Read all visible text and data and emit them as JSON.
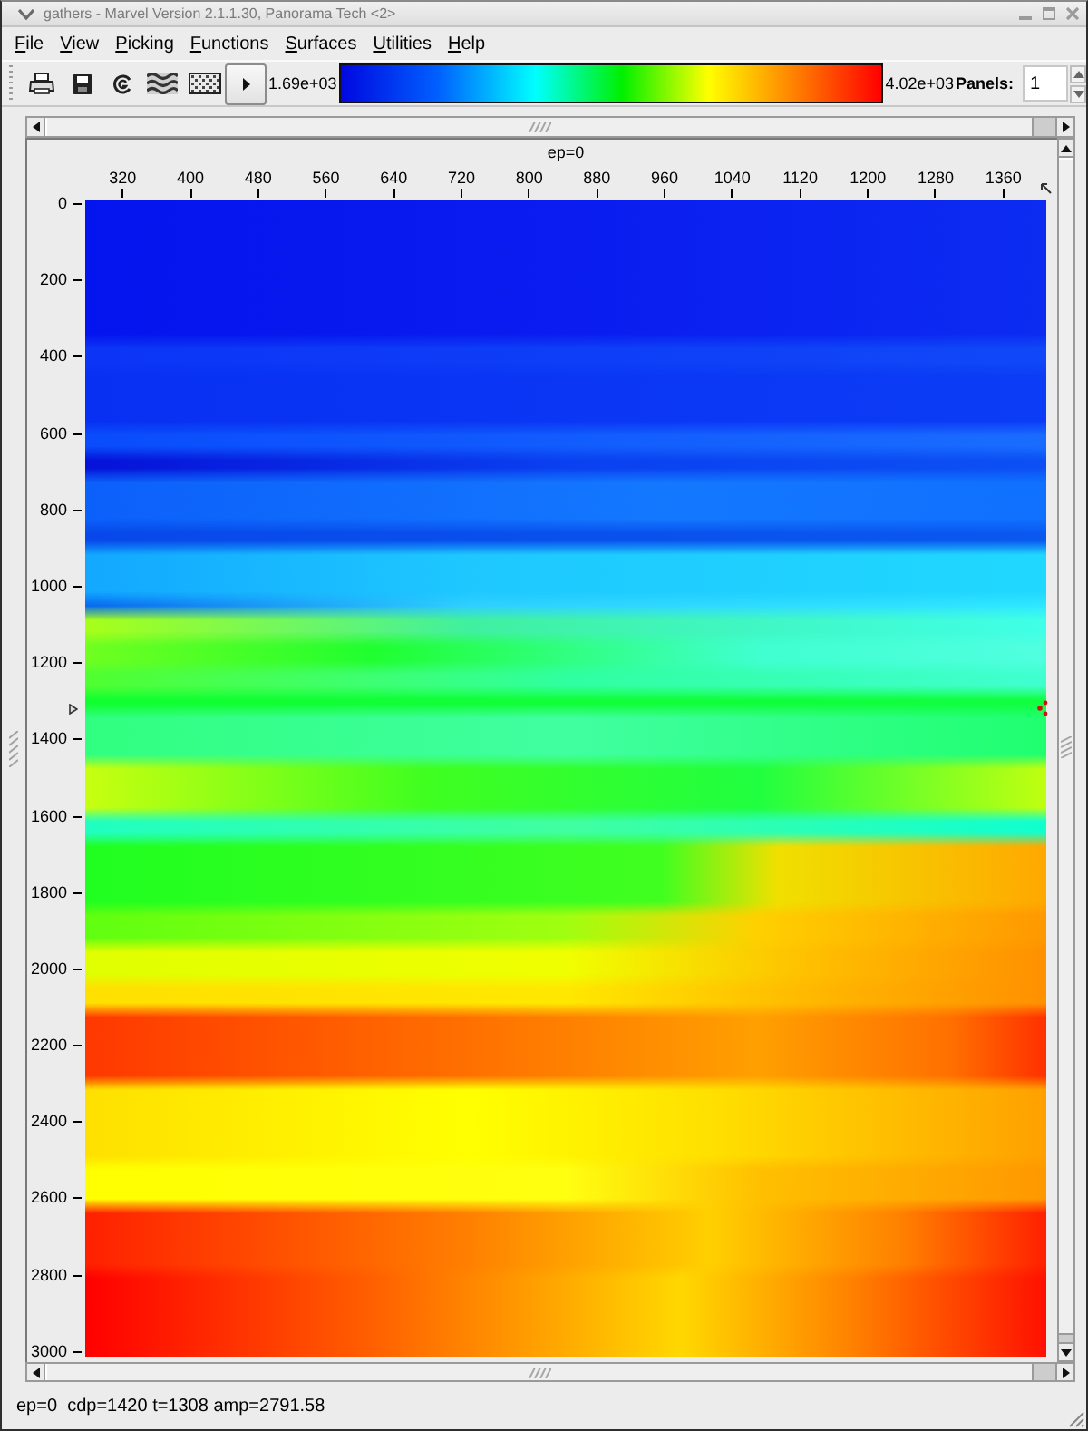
{
  "window": {
    "title": "gathers - Marvel Version 2.1.1.30, Panorama Tech <2>"
  },
  "menu": [
    "File",
    "View",
    "Picking",
    "Functions",
    "Surfaces",
    "Utilities",
    "Help"
  ],
  "toolbar": {
    "scale_min": "1.69e+03",
    "scale_max": "4.02e+03",
    "panels_label": "Panels:",
    "panels_value": "1"
  },
  "plot": {
    "title": "ep=0",
    "x_ticks": [
      "320",
      "400",
      "480",
      "560",
      "640",
      "720",
      "800",
      "880",
      "960",
      "1040",
      "1120",
      "1200",
      "1280",
      "1360"
    ],
    "y_ticks": [
      "0",
      "200",
      "400",
      "600",
      "800",
      "1000",
      "1200",
      "1400",
      "1600",
      "1800",
      "2000",
      "2200",
      "2400",
      "2600",
      "2800",
      "3000"
    ]
  },
  "status_bar": "ep=0  cdp=1420 t=1308 amp=2791.58"
}
